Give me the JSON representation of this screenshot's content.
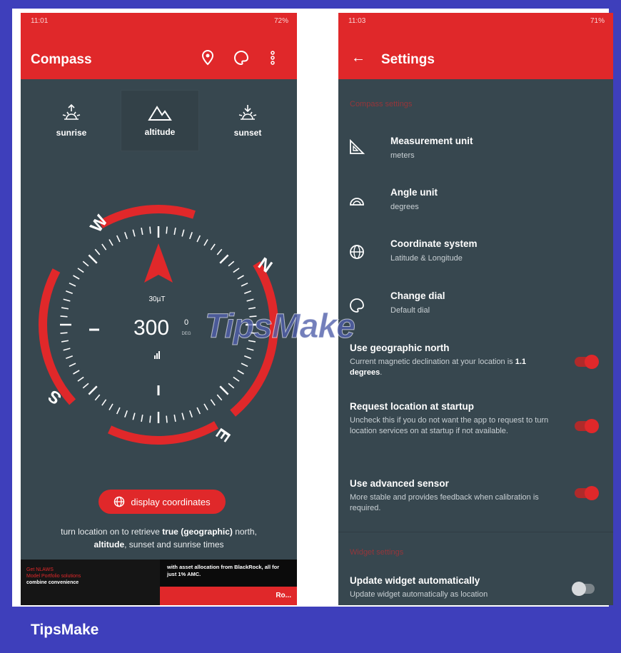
{
  "compass_screen": {
    "status_time": "11:01",
    "status_right": "72%",
    "title": "Compass",
    "icons": [
      "location-pin-icon",
      "palette-icon",
      "more-vert-icon"
    ],
    "chips": [
      {
        "label": "sunrise",
        "icon": "sunrise-icon"
      },
      {
        "label": "altitude",
        "icon": "mountain-icon"
      },
      {
        "label": "sunset",
        "icon": "sunset-icon"
      }
    ],
    "directions": {
      "n": "N",
      "e": "E",
      "s": "S",
      "w": "W"
    },
    "magnetic_field": "30µT",
    "heading": "300",
    "heading_decimal": "0",
    "heading_unit": "DEG",
    "display_coordinates_label": "display coordinates",
    "info_text_a": "turn location on to retrieve ",
    "info_bold_1": "true (geographic)",
    "info_text_b": " north,",
    "info_bold_2": "altitude",
    "info_text_c": ", sunset and sunrise times",
    "ad": {
      "left_line1": "Get NLAWS",
      "left_line2": "Model Portfolio solutions",
      "left_line3": "combine convenience",
      "right_text": "with asset allocation from BlackRock, all for just 1% AMC.",
      "cta": "Ro..."
    }
  },
  "settings_screen": {
    "status_time": "11:03",
    "status_right": "71%",
    "title": "Settings",
    "section1": "Compass settings",
    "items": [
      {
        "title": "Measurement unit",
        "subtitle": "meters",
        "icon": "ruler-triangle-icon"
      },
      {
        "title": "Angle unit",
        "subtitle": "degrees",
        "icon": "protractor-icon"
      },
      {
        "title": "Coordinate system",
        "subtitle": "Latitude & Longitude",
        "icon": "globe-icon"
      },
      {
        "title": "Change dial",
        "subtitle": "Default dial",
        "icon": "palette-icon"
      }
    ],
    "toggles": [
      {
        "title": "Use geographic north",
        "subtitle": "Current magnetic declination at your location is ",
        "subtitle_bold": "1.1 degrees",
        "subtitle_end": ".",
        "on": true
      },
      {
        "title": "Request location at startup",
        "subtitle": "Uncheck this if you do not want the app to request to turn location services on at startup if not available.",
        "on": true
      },
      {
        "title": "Use advanced sensor",
        "subtitle": "More stable and provides feedback when calibration is required.",
        "on": true
      }
    ],
    "section2": "Widget settings",
    "widget_title": "Update widget automatically",
    "widget_subtitle": "Update widget automatically as location",
    "widget_on": false
  },
  "watermark": "TipsMake",
  "brand": "TipsMake",
  "colors": {
    "accent": "#e0282a",
    "panel": "#37474f",
    "frame_bg": "#3e3fbb"
  }
}
